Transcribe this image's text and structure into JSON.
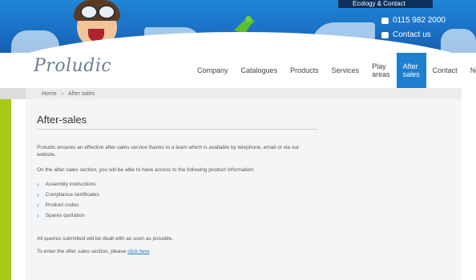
{
  "topbar": {
    "tab_label": "Ecology & Contact"
  },
  "header": {
    "phone": "0115 982 2000",
    "contact": "Contact us"
  },
  "logo": {
    "text": "Proludic"
  },
  "nav": {
    "items": [
      {
        "label": "Company"
      },
      {
        "label": "Catalogues"
      },
      {
        "label": "Products"
      },
      {
        "label": "Services"
      },
      {
        "label": "Play areas"
      },
      {
        "label": "After sales",
        "active": true
      },
      {
        "label": "Contact"
      },
      {
        "label": "News"
      }
    ]
  },
  "breadcrumb": {
    "home": "Home",
    "separator": "›",
    "current": "After sales"
  },
  "main": {
    "title": "After-sales",
    "intro": "Proludic ensures an effective after-sales service thanks to a team which is available by telephone, email or via our website.",
    "section_text": "On the after-sales section, you will be able to have access to the following product information:",
    "list": [
      "Assembly instructions",
      "Compliance certificates",
      "Product codes",
      "Spares quotation"
    ],
    "note": "All queries submitted will be dealt with as soon as possible.",
    "link_prefix": "To enter the after sales section, please",
    "link_text": "click here"
  },
  "colors": {
    "brand_blue": "#1e7fd0",
    "accent_green": "#a8c81a"
  }
}
